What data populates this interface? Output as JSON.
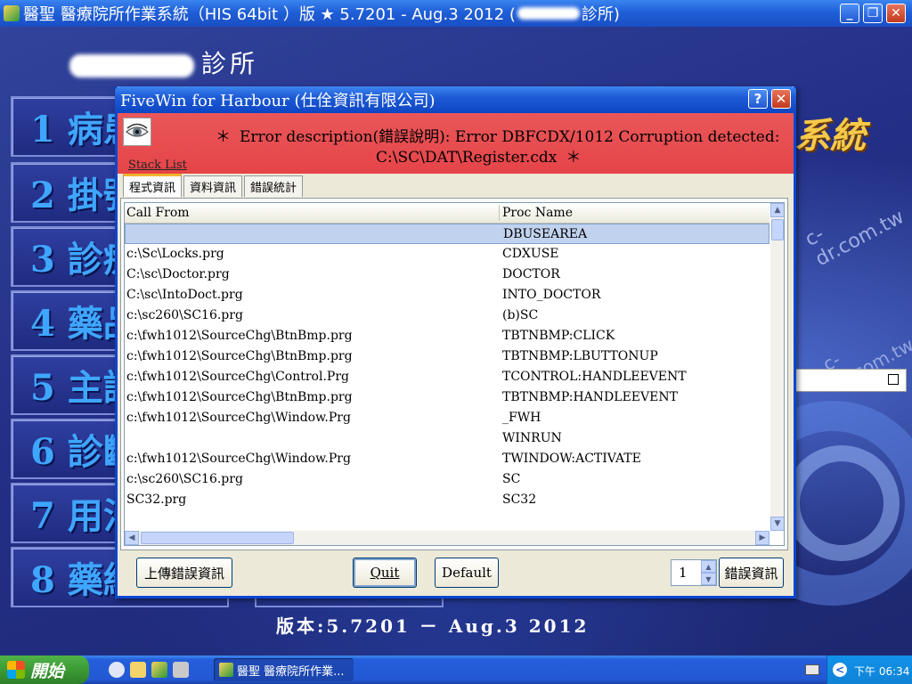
{
  "app": {
    "title": "醫聖 醫療院所作業系統（HIS 64bit ）版 ★ 5.7201 - Aug.3 2012 (",
    "title_suffix": "診所)",
    "clinic_suffix": "診所",
    "menu": [
      "1 病患",
      "2 掛號",
      "3 診療",
      "4 藥品",
      "5 主訴",
      "6 診斷",
      "7 用法",
      "8 藥組"
    ],
    "sys_title_right": "系統",
    "watermark": "c-dr.com.tw",
    "version_text": "版本:5.7201 － Aug.3 2012"
  },
  "dialog": {
    "title": "FiveWin for Harbour (仕佺資訊有限公司)",
    "help_label": "?",
    "close_label": "✕",
    "error_line1": "Error description(錯誤說明): Error DBFCDX/1012  Corruption detected:",
    "error_line2": "C:\\SC\\DAT\\Register.cdx",
    "star": "＊",
    "stack_list_label": "Stack List",
    "tabs": [
      "程式資訊",
      "資料資訊",
      "錯誤統計"
    ],
    "columns": [
      "Call From",
      "Proc Name"
    ],
    "rows": [
      {
        "call_from": "",
        "proc_name": "DBUSEAREA"
      },
      {
        "call_from": "c:\\Sc\\Locks.prg",
        "proc_name": "CDXUSE"
      },
      {
        "call_from": "C:\\sc\\Doctor.prg",
        "proc_name": "DOCTOR"
      },
      {
        "call_from": "C:\\sc\\IntoDoct.prg",
        "proc_name": "INTO_DOCTOR"
      },
      {
        "call_from": "c:\\sc260\\SC16.prg",
        "proc_name": "(b)SC"
      },
      {
        "call_from": "c:\\fwh1012\\SourceChg\\BtnBmp.prg",
        "proc_name": "TBTNBMP:CLICK"
      },
      {
        "call_from": "c:\\fwh1012\\SourceChg\\BtnBmp.prg",
        "proc_name": "TBTNBMP:LBUTTONUP"
      },
      {
        "call_from": "c:\\fwh1012\\SourceChg\\Control.Prg",
        "proc_name": "TCONTROL:HANDLEEVENT"
      },
      {
        "call_from": "c:\\fwh1012\\SourceChg\\BtnBmp.prg",
        "proc_name": "TBTNBMP:HANDLEEVENT"
      },
      {
        "call_from": "c:\\fwh1012\\SourceChg\\Window.Prg",
        "proc_name": "_FWH"
      },
      {
        "call_from": "",
        "proc_name": "WINRUN"
      },
      {
        "call_from": "c:\\fwh1012\\SourceChg\\Window.Prg",
        "proc_name": "TWINDOW:ACTIVATE"
      },
      {
        "call_from": "c:\\sc260\\SC16.prg",
        "proc_name": "SC"
      },
      {
        "call_from": "SC32.prg",
        "proc_name": "SC32"
      }
    ],
    "buttons": {
      "upload": "上傳錯誤資訊",
      "quit": "Quit",
      "default": "Default",
      "error_info": "錯誤資訊"
    },
    "spinner_value": "1"
  },
  "taskbar": {
    "start_label": "開始",
    "task_item": "醫聖 醫療院所作業...",
    "clock": "下午 06:34",
    "tray_arrow": "<"
  },
  "colors": {
    "title_blue": "#1f5fd8",
    "error_red": "#e54448",
    "tab_accent": "#f2b52c",
    "selected_row": "#c1d2ee"
  }
}
